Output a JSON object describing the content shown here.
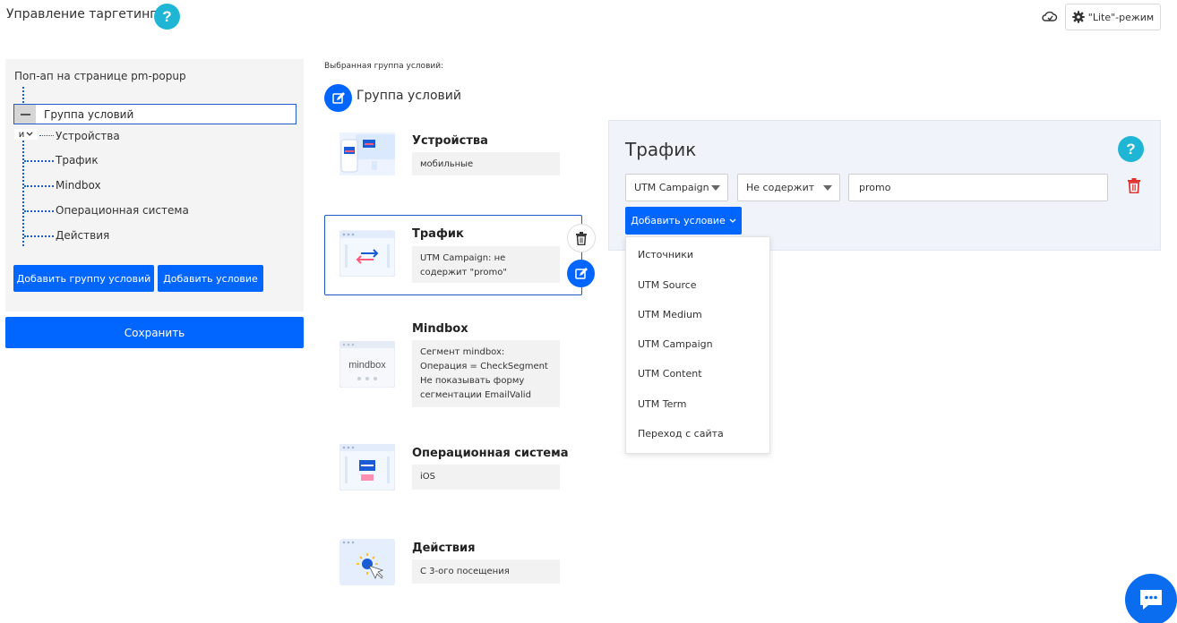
{
  "header": {
    "title": "Управление таргетингом",
    "help_label": "?",
    "lite_mode_label": "\"Lite\"-режим"
  },
  "tree": {
    "root": "Поп-ап на странице pm-popup",
    "group_label": "Группа условий",
    "operator": "и",
    "items": [
      "Устройства",
      "Трафик",
      "Mindbox",
      "Операционная система",
      "Действия"
    ],
    "add_group_button": "Добавить группу условий",
    "add_condition_button": "Добавить условие",
    "save_button": "Сохранить"
  },
  "selected": {
    "label": "Выбранная группа условий:",
    "group_title": "Группа условий"
  },
  "cards": [
    {
      "title": "Устройства",
      "desc": "мобильные"
    },
    {
      "title": "Трафик",
      "desc": "UTM Campaign: не содержит \"promo\""
    },
    {
      "title": "Mindbox",
      "desc": "Сегмент mindbox:\nОперация = CheckSegment\nНе показывать форму сегментации EmailValid",
      "icon_text": "mindbox"
    },
    {
      "title": "Операционная система",
      "desc": "iOS"
    },
    {
      "title": "Действия",
      "desc": "С 3-ого посещения"
    }
  ],
  "editor": {
    "title": "Трафик",
    "help_label": "?",
    "field_select": "UTM Campaign",
    "operator_select": "Не содержит",
    "value_input": "promo",
    "add_condition_button": "Добавить условие",
    "dropdown_options": [
      "Источники",
      "UTM Source",
      "UTM Medium",
      "UTM Campaign",
      "UTM Content",
      "UTM Term",
      "Переход с сайта"
    ]
  },
  "colors": {
    "primary": "#0066ff",
    "help": "#1fb6d6",
    "danger": "#e0302b",
    "panel": "#f4f4f4"
  }
}
